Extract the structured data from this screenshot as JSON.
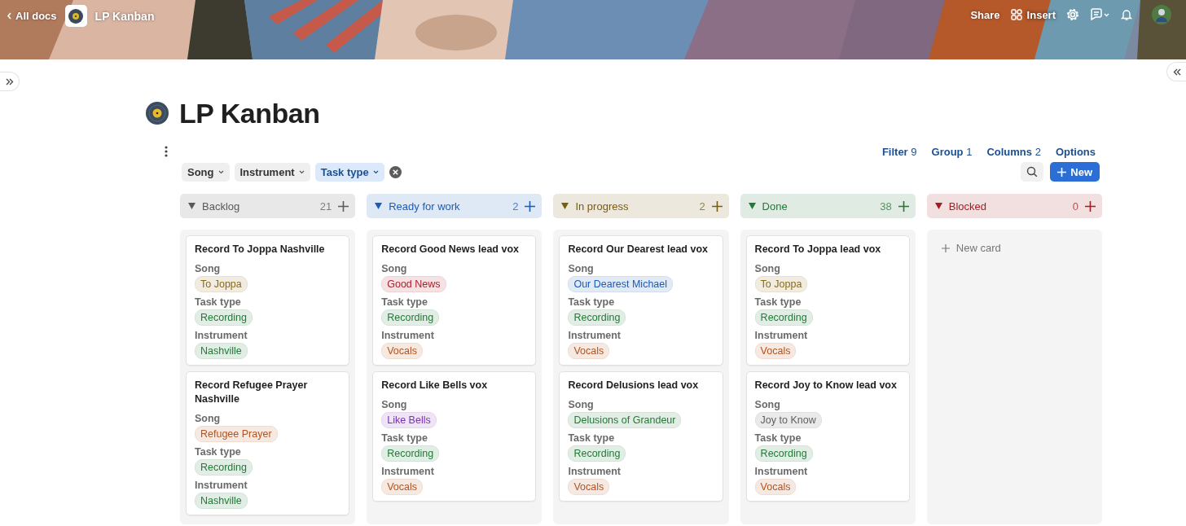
{
  "banner": {
    "back_link": "All docs",
    "doc_title": "LP Kanban",
    "actions": [
      {
        "label": "Share"
      },
      {
        "label": "Insert"
      }
    ]
  },
  "title": "LP Kanban",
  "view_links": [
    {
      "label": "Filter",
      "count": "9"
    },
    {
      "label": "Group",
      "count": "1"
    },
    {
      "label": "Columns",
      "count": "2"
    },
    {
      "label": "Options"
    }
  ],
  "filter_chips": [
    {
      "label": "Song",
      "selected": false
    },
    {
      "label": "Instrument",
      "selected": false
    },
    {
      "label": "Task type",
      "selected": true
    }
  ],
  "new_button": "New",
  "columns": [
    {
      "name": "Backlog",
      "count": "21",
      "color": "#5a5a5a",
      "cards": [
        {
          "title": "Record To Joppa Nashville",
          "fields": [
            {
              "label": "Song",
              "tag": "To Joppa",
              "color": "#8a6a1a"
            },
            {
              "label": "Task type",
              "tag": "Recording",
              "color": "#217a36"
            },
            {
              "label": "Instrument",
              "tag": "Nashville",
              "color": "#217a36"
            }
          ]
        },
        {
          "title": "Record Refugee Prayer Nashville",
          "fields": [
            {
              "label": "Song",
              "tag": "Refugee Prayer",
              "color": "#b4531f"
            },
            {
              "label": "Task type",
              "tag": "Recording",
              "color": "#217a36"
            },
            {
              "label": "Instrument",
              "tag": "Nashville",
              "color": "#217a36"
            }
          ]
        }
      ]
    },
    {
      "name": "Ready for work",
      "count": "2",
      "color": "#1a5cb8",
      "cards": [
        {
          "title": "Record Good News lead vox",
          "fields": [
            {
              "label": "Song",
              "tag": "Good News",
              "color": "#a8222c"
            },
            {
              "label": "Task type",
              "tag": "Recording",
              "color": "#217a36"
            },
            {
              "label": "Instrument",
              "tag": "Vocals",
              "color": "#b4531f"
            }
          ]
        },
        {
          "title": "Record Like Bells vox",
          "fields": [
            {
              "label": "Song",
              "tag": "Like Bells",
              "color": "#7a2fb4"
            },
            {
              "label": "Task type",
              "tag": "Recording",
              "color": "#217a36"
            },
            {
              "label": "Instrument",
              "tag": "Vocals",
              "color": "#b4531f"
            }
          ]
        }
      ]
    },
    {
      "name": "In progress",
      "count": "2",
      "color": "#7a5c10",
      "cards": [
        {
          "title": "Record Our Dearest lead vox",
          "fields": [
            {
              "label": "Song",
              "tag": "Our Dearest Michael",
              "color": "#1f5bb0"
            },
            {
              "label": "Task type",
              "tag": "Recording",
              "color": "#217a36"
            },
            {
              "label": "Instrument",
              "tag": "Vocals",
              "color": "#b4531f"
            }
          ]
        },
        {
          "title": "Record Delusions lead vox",
          "fields": [
            {
              "label": "Song",
              "tag": "Delusions of Grandeur",
              "color": "#217a36"
            },
            {
              "label": "Task type",
              "tag": "Recording",
              "color": "#217a36"
            },
            {
              "label": "Instrument",
              "tag": "Vocals",
              "color": "#b4531f"
            }
          ]
        }
      ]
    },
    {
      "name": "Done",
      "count": "38",
      "color": "#1e7a34",
      "cards": [
        {
          "title": "Record To Joppa lead vox",
          "fields": [
            {
              "label": "Song",
              "tag": "To Joppa",
              "color": "#8a6a1a"
            },
            {
              "label": "Task type",
              "tag": "Recording",
              "color": "#217a36"
            },
            {
              "label": "Instrument",
              "tag": "Vocals",
              "color": "#b4531f"
            }
          ]
        },
        {
          "title": "Record Joy to Know lead vox",
          "fields": [
            {
              "label": "Song",
              "tag": "Joy to Know",
              "color": "#5f5f5f"
            },
            {
              "label": "Task type",
              "tag": "Recording",
              "color": "#217a36"
            },
            {
              "label": "Instrument",
              "tag": "Vocals",
              "color": "#b4531f"
            }
          ]
        }
      ]
    },
    {
      "name": "Blocked",
      "count": "0",
      "color": "#a51d24",
      "new_card": "New card"
    }
  ]
}
